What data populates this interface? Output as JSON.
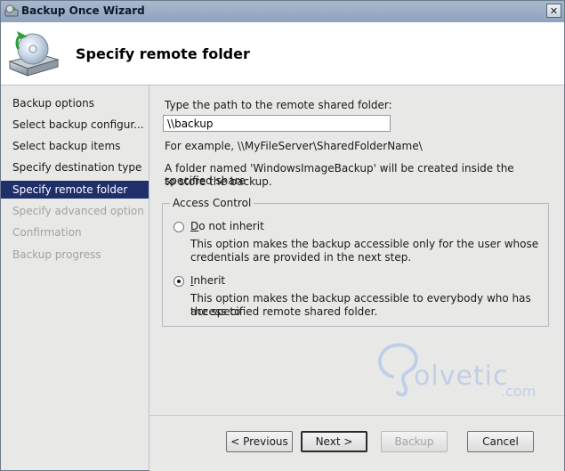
{
  "window": {
    "title": "Backup Once Wizard",
    "close_glyph": "✕"
  },
  "header": {
    "title": "Specify remote folder",
    "icon": "backup-drive-icon"
  },
  "sidebar": {
    "items": [
      {
        "label": "Backup options",
        "state": "normal"
      },
      {
        "label": "Select backup configur...",
        "state": "normal"
      },
      {
        "label": "Select backup items",
        "state": "normal"
      },
      {
        "label": "Specify destination type",
        "state": "normal"
      },
      {
        "label": "Specify remote folder",
        "state": "active"
      },
      {
        "label": "Specify advanced option",
        "state": "disabled"
      },
      {
        "label": "Confirmation",
        "state": "disabled"
      },
      {
        "label": "Backup progress",
        "state": "disabled"
      }
    ]
  },
  "main": {
    "path_prompt": "Type the path to the remote shared folder:",
    "path_value": "\\\\backup",
    "example": "For example, \\\\MyFileServer\\SharedFolderName\\",
    "note_line1": "A folder named 'WindowsImageBackup' will be created inside the specified share",
    "note_line2": "to store the backup.",
    "access_control": {
      "legend": "Access Control",
      "options": [
        {
          "label": "Do not inherit",
          "selected": false,
          "desc_line1": "This option makes the backup accessible only for the user whose",
          "desc_line2": "credentials are provided in the next step."
        },
        {
          "label": "Inherit",
          "selected": true,
          "desc_line1": "This option makes the backup accessible to everybody who has access to",
          "desc_line2": "the specified remote shared folder."
        }
      ]
    }
  },
  "watermark": {
    "text": "olvetic",
    "suffix": ".com"
  },
  "footer": {
    "previous": "< Previous",
    "next": "Next >",
    "backup": "Backup",
    "cancel": "Cancel"
  },
  "colors": {
    "active_nav": "#1f2f6a",
    "panel_bg": "#e8e8e6",
    "title_bar": "#8ea3bd"
  }
}
